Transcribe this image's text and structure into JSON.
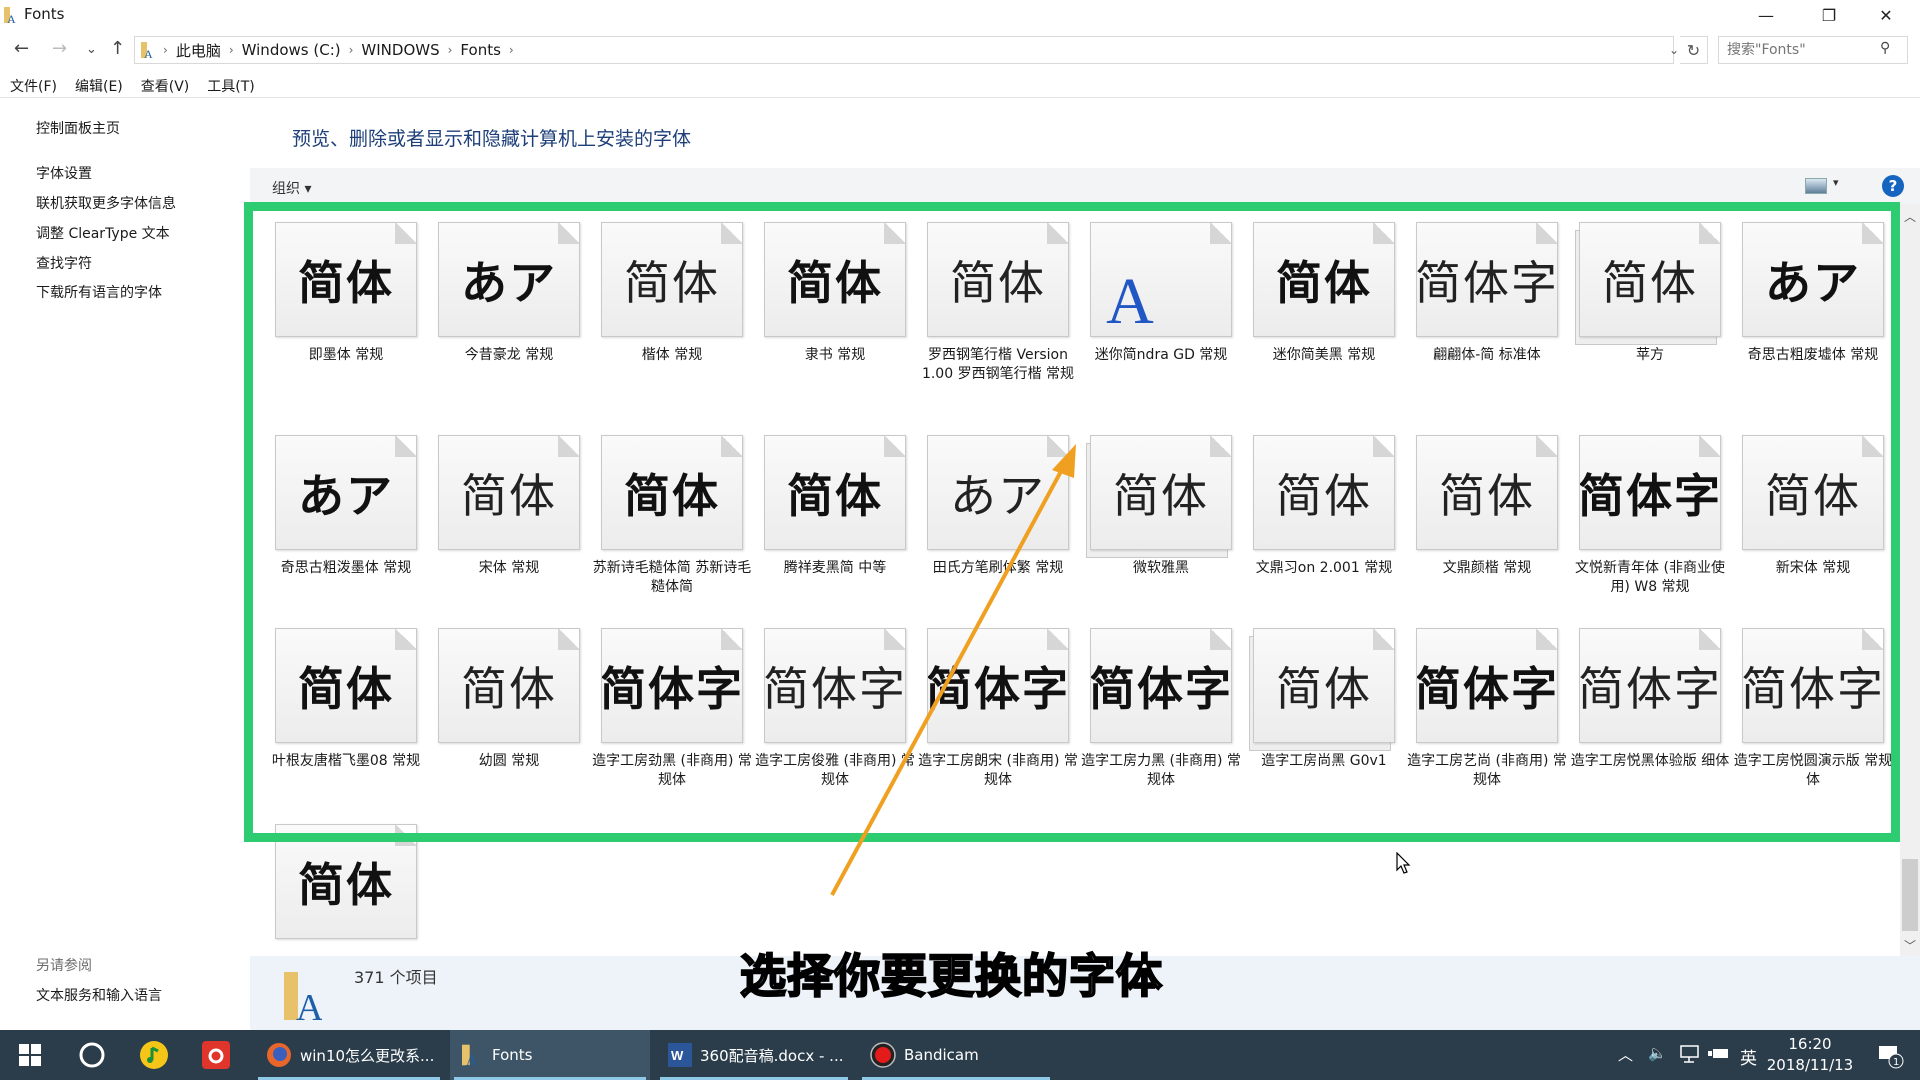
{
  "window": {
    "title": "Fonts",
    "controls": {
      "minimize": "—",
      "maximize": "❐",
      "close": "✕"
    }
  },
  "address": {
    "back": "←",
    "forward": "→",
    "recent": "⌄",
    "up": "↑",
    "breadcrumbs": [
      "此电脑",
      "Windows (C:)",
      "WINDOWS",
      "Fonts"
    ],
    "refresh": "↻",
    "search_placeholder": "搜索\"Fonts\"",
    "search_icon": "⚲"
  },
  "menubar": [
    "文件(F)",
    "编辑(E)",
    "查看(V)",
    "工具(T)"
  ],
  "sidebar": {
    "home": "控制面板主页",
    "links": [
      "字体设置",
      "联机获取更多字体信息",
      "调整 ClearType 文本",
      "查找字符",
      "下载所有语言的字体"
    ],
    "see_also_heading": "另请参阅",
    "see_also_links": [
      "文本服务和输入语言"
    ]
  },
  "page_title": "预览、删除或者显示和隐藏计算机上安装的字体",
  "command_bar": {
    "organize": "组织 ▾",
    "view_dropdown": "▾",
    "help": "?"
  },
  "fonts": [
    {
      "name": "即墨体 常规",
      "preview": "简体",
      "style": "bold serif"
    },
    {
      "name": "今昔豪龙 常规",
      "preview": "あア",
      "style": "bold serif"
    },
    {
      "name": "楷体 常规",
      "preview": "简体",
      "style": "light serif"
    },
    {
      "name": "隶书 常规",
      "preview": "简体",
      "style": "bold serif"
    },
    {
      "name": "罗西钢笔行楷 Version 1.00 罗西钢笔行楷 常规",
      "preview": "简体",
      "style": "light"
    },
    {
      "name": "迷你简ndra GD 常规",
      "preview": "A",
      "style": "a"
    },
    {
      "name": "迷你简美黑 常规",
      "preview": "简体",
      "style": "bold"
    },
    {
      "name": "翩翩体-简 标准体",
      "preview": "简体字",
      "style": "light"
    },
    {
      "name": "苹方",
      "preview": "简体",
      "style": "light",
      "stack": true
    },
    {
      "name": "奇思古粗废墟体 常规",
      "preview": "あア",
      "style": "bold"
    },
    {
      "name": "奇思古粗泼墨体 常规",
      "preview": "あア",
      "style": "bold"
    },
    {
      "name": "宋体 常规",
      "preview": "简体",
      "style": "light serif"
    },
    {
      "name": "苏新诗毛糙体简 苏新诗毛糙体简",
      "preview": "简体",
      "style": "bold serif"
    },
    {
      "name": "腾祥麦黑简 中等",
      "preview": "简体",
      "style": "bold"
    },
    {
      "name": "田氏方笔刷体繁 常规",
      "preview": "あア",
      "style": "light serif"
    },
    {
      "name": "微软雅黑",
      "preview": "简体",
      "style": "light",
      "stack": true
    },
    {
      "name": "文鼎习on 2.001 常规",
      "preview": "简体",
      "style": "light"
    },
    {
      "name": "文鼎颜楷 常规",
      "preview": "简体",
      "style": "light"
    },
    {
      "name": "文悦新青年体 (非商业使用) W8 常规",
      "preview": "简体字",
      "style": "bold"
    },
    {
      "name": "新宋体 常规",
      "preview": "简体",
      "style": "light serif"
    },
    {
      "name": "叶根友唐楷飞墨08 常规",
      "preview": "简体",
      "style": "bold serif"
    },
    {
      "name": "幼圆 常规",
      "preview": "简体",
      "style": "light"
    },
    {
      "name": "造字工房劲黑 (非商用) 常规体",
      "preview": "简体字",
      "style": "bold"
    },
    {
      "name": "造字工房俊雅 (非商用) 常规体",
      "preview": "简体字",
      "style": "light"
    },
    {
      "name": "造字工房朗宋 (非商用) 常规体",
      "preview": "简体字",
      "style": "bold serif"
    },
    {
      "name": "造字工房力黑 (非商用) 常规体",
      "preview": "简体字",
      "style": "bold"
    },
    {
      "name": "造字工房尚黑 G0v1",
      "preview": "简体",
      "style": "light",
      "stack": true
    },
    {
      "name": "造字工房艺尚 (非商用) 常规体",
      "preview": "简体字",
      "style": "bold"
    },
    {
      "name": "造字工房悦黑体验版 细体",
      "preview": "简体字",
      "style": "light"
    },
    {
      "name": "造字工房悦圆演示版 常规体",
      "preview": "简体字",
      "style": "light"
    },
    {
      "name": "",
      "preview": "简体",
      "style": "bold"
    }
  ],
  "status": {
    "count": "371 个项目"
  },
  "subtitle": "选择你要更换的字体",
  "highlight_color": "#2ecc71",
  "arrow_color": "#f0a020",
  "taskbar": {
    "apps": [
      {
        "label": "win10怎么更改系...",
        "icon": "firefox-icon"
      },
      {
        "label": "Fonts",
        "icon": "fonts-folder-icon"
      },
      {
        "label": "360配音稿.docx - ...",
        "icon": "word-icon"
      },
      {
        "label": "Bandicam",
        "icon": "bandicam-icon"
      }
    ],
    "tray": {
      "chevron": "︿",
      "volume": "🔈",
      "ime": "英"
    },
    "time": "16:20",
    "date": "2018/11/13",
    "notifications": "1"
  }
}
